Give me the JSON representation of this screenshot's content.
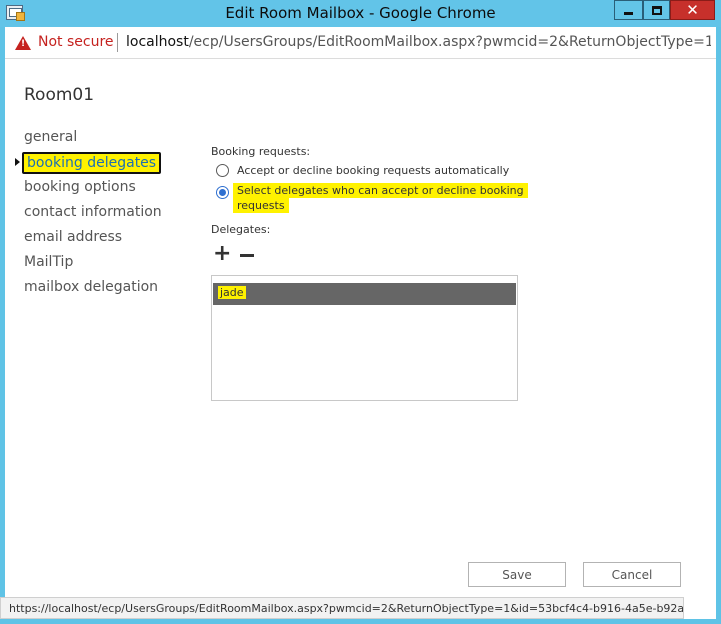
{
  "window": {
    "title": "Edit Room Mailbox - Google Chrome",
    "close_glyph": "✕"
  },
  "address_bar": {
    "security_label": "Not secure",
    "url_host": "localhost",
    "url_path": "/ecp/UsersGroups/EditRoomMailbox.aspx?pwmcid=2&ReturnObjectType=1&id=5..."
  },
  "page": {
    "title": "Room01",
    "nav": [
      {
        "label": "general"
      },
      {
        "label": "booking delegates",
        "active": true
      },
      {
        "label": "booking options"
      },
      {
        "label": "contact information"
      },
      {
        "label": "email address"
      },
      {
        "label": "MailTip"
      },
      {
        "label": "mailbox delegation"
      }
    ]
  },
  "booking": {
    "requests_label": "Booking requests:",
    "option_auto": "Accept or decline booking requests automatically",
    "option_delegates_line1": "Select delegates who can accept or decline booking",
    "option_delegates_line2": "requests",
    "selected_option": "delegates",
    "delegates_label": "Delegates:",
    "delegates": [
      "jade"
    ]
  },
  "buttons": {
    "save": "Save",
    "cancel": "Cancel"
  },
  "status_bar": {
    "text": "https://localhost/ecp/UsersGroups/EditRoomMailbox.aspx?pwmcid=2&ReturnObjectType=1&id=53bcf4c4-b916-4a5e-b92a..."
  },
  "colors": {
    "titlebar": "#62c4e8",
    "highlight": "#fff200",
    "link_blue": "#1b6fb3",
    "selected_row": "#666666",
    "warning_red": "#c5221f"
  },
  "icons": [
    "mailbox-app-icon",
    "minimize-icon",
    "maximize-icon",
    "close-icon",
    "warning-icon",
    "nav-arrow-icon",
    "add-icon",
    "remove-icon"
  ]
}
